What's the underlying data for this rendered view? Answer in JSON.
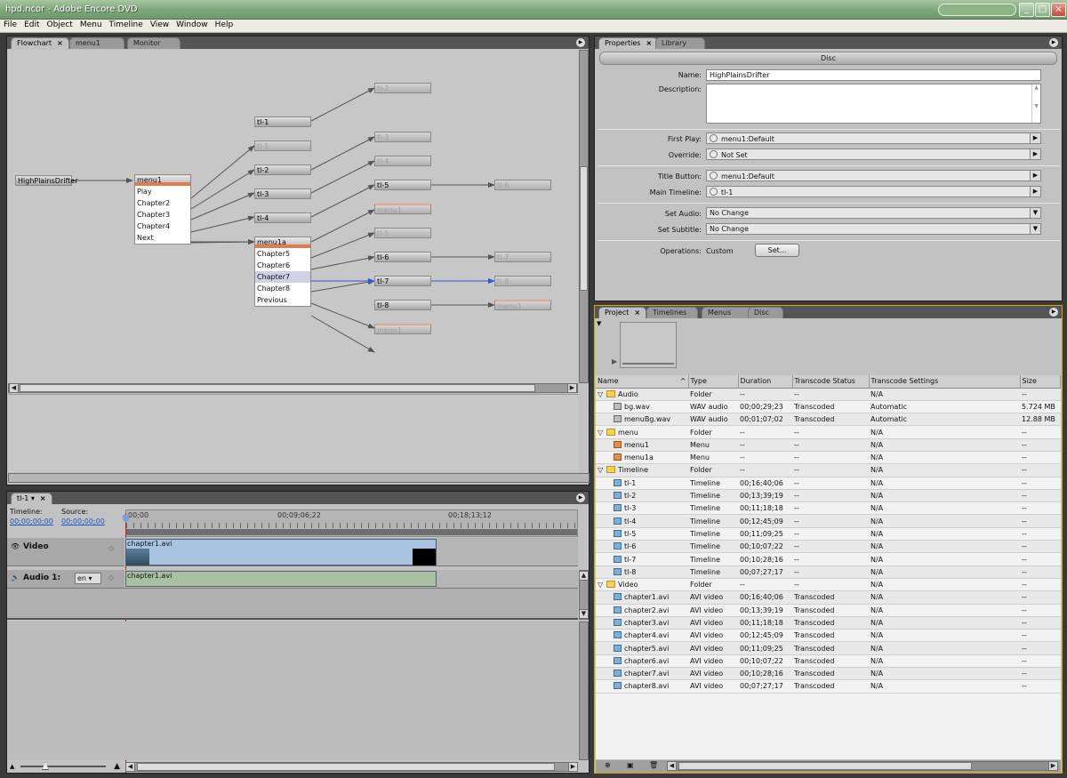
{
  "window": {
    "title": "hpd.ncor - Adobe Encore DVD"
  },
  "menubar": [
    "File",
    "Edit",
    "Object",
    "Menu",
    "Timeline",
    "View",
    "Window",
    "Help"
  ],
  "flowchart_panel": {
    "tabs": [
      "Flowchart",
      "menu1",
      "Monitor"
    ],
    "source_node": "HighPlainsDrifter",
    "menu1": {
      "title": "menu1",
      "items": [
        "Play",
        "Chapter2",
        "Chapter3",
        "Chapter4",
        "Next"
      ]
    },
    "menu1a": {
      "title": "menu1a",
      "items": [
        "Chapter5",
        "Chapter6",
        "Chapter7",
        "Chapter8",
        "Previous"
      ],
      "selected": "Chapter7"
    },
    "col2_nodes": [
      "tl-1",
      "tl-1",
      "tl-2",
      "tl-3",
      "tl-4"
    ],
    "col3_nodes": [
      "tl-2",
      "tl-3",
      "tl-4",
      "tl-5",
      "menu1",
      "tl-5",
      "tl-6",
      "tl-7",
      "tl-8",
      "menu1"
    ],
    "col4_nodes": [
      "tl-6",
      "tl-7",
      "tl-8",
      "menu1"
    ]
  },
  "timeline_panel": {
    "tab": "tl-1",
    "timeline_label": "Timeline:",
    "timeline_tc": "00;00;00;00",
    "source_label": "Source:",
    "source_tc": "00;00;00;00",
    "ruler": [
      "00;00",
      "00;09;06;22",
      "00;18;13;12"
    ],
    "video_track": "Video",
    "video_clip": "chapter1.avi",
    "audio_track": "Audio 1:",
    "audio_lang": "en",
    "audio_clip": "chapter1.avi"
  },
  "properties_panel": {
    "tabs": [
      "Properties",
      "Library"
    ],
    "header": "Disc",
    "name_label": "Name:",
    "name_value": "HighPlainsDrifter",
    "desc_label": "Description:",
    "first_play_label": "First Play:",
    "first_play_value": "menu1:Default",
    "override_label": "Override:",
    "override_value": "Not Set",
    "title_button_label": "Title Button:",
    "title_button_value": "menu1:Default",
    "main_timeline_label": "Main Timeline:",
    "main_timeline_value": "tl-1",
    "set_audio_label": "Set Audio:",
    "set_audio_value": "No Change",
    "set_subtitle_label": "Set Subtitle:",
    "set_subtitle_value": "No Change",
    "operations_label": "Operations:",
    "operations_value": "Custom",
    "set_button": "Set..."
  },
  "project_panel": {
    "tabs": [
      "Project",
      "Timelines",
      "Menus",
      "Disc"
    ],
    "columns": [
      "Name",
      "Type",
      "Duration",
      "Transcode Status",
      "Transcode Settings",
      "Size"
    ],
    "rows": [
      {
        "name": "Audio",
        "type": "Folder",
        "duration": "--",
        "status": "--",
        "settings": "N/A",
        "size": "--",
        "kind": "folder",
        "indent": 0
      },
      {
        "name": "bg.wav",
        "type": "WAV audio",
        "duration": "00;00;29;23",
        "status": "Transcoded",
        "settings": "Automatic",
        "size": "5.724 MB",
        "kind": "audio",
        "indent": 1
      },
      {
        "name": "menuBg.wav",
        "type": "WAV audio",
        "duration": "00;01;07;02",
        "status": "Transcoded",
        "settings": "Automatic",
        "size": "12.88 MB",
        "kind": "audio",
        "indent": 1
      },
      {
        "name": "menu",
        "type": "Folder",
        "duration": "--",
        "status": "--",
        "settings": "N/A",
        "size": "--",
        "kind": "folder",
        "indent": 0
      },
      {
        "name": "menu1",
        "type": "Menu",
        "duration": "--",
        "status": "--",
        "settings": "N/A",
        "size": "--",
        "kind": "menu",
        "indent": 1
      },
      {
        "name": "menu1a",
        "type": "Menu",
        "duration": "--",
        "status": "--",
        "settings": "N/A",
        "size": "--",
        "kind": "menu",
        "indent": 1
      },
      {
        "name": "Timeline",
        "type": "Folder",
        "duration": "--",
        "status": "--",
        "settings": "N/A",
        "size": "--",
        "kind": "folder",
        "indent": 0
      },
      {
        "name": "tl-1",
        "type": "Timeline",
        "duration": "00;16;40;06",
        "status": "--",
        "settings": "N/A",
        "size": "--",
        "kind": "timeline",
        "indent": 1
      },
      {
        "name": "tl-2",
        "type": "Timeline",
        "duration": "00;13;39;19",
        "status": "--",
        "settings": "N/A",
        "size": "--",
        "kind": "timeline",
        "indent": 1
      },
      {
        "name": "tl-3",
        "type": "Timeline",
        "duration": "00;11;18;18",
        "status": "--",
        "settings": "N/A",
        "size": "--",
        "kind": "timeline",
        "indent": 1
      },
      {
        "name": "tl-4",
        "type": "Timeline",
        "duration": "00;12;45;09",
        "status": "--",
        "settings": "N/A",
        "size": "--",
        "kind": "timeline",
        "indent": 1
      },
      {
        "name": "tl-5",
        "type": "Timeline",
        "duration": "00;11;09;25",
        "status": "--",
        "settings": "N/A",
        "size": "--",
        "kind": "timeline",
        "indent": 1
      },
      {
        "name": "tl-6",
        "type": "Timeline",
        "duration": "00;10;07;22",
        "status": "--",
        "settings": "N/A",
        "size": "--",
        "kind": "timeline",
        "indent": 1
      },
      {
        "name": "tl-7",
        "type": "Timeline",
        "duration": "00;10;28;16",
        "status": "--",
        "settings": "N/A",
        "size": "--",
        "kind": "timeline",
        "indent": 1
      },
      {
        "name": "tl-8",
        "type": "Timeline",
        "duration": "00;07;27;17",
        "status": "--",
        "settings": "N/A",
        "size": "--",
        "kind": "timeline",
        "indent": 1
      },
      {
        "name": "Video",
        "type": "Folder",
        "duration": "--",
        "status": "--",
        "settings": "N/A",
        "size": "--",
        "kind": "folder",
        "indent": 0
      },
      {
        "name": "chapter1.avi",
        "type": "AVI video",
        "duration": "00;16;40;06",
        "status": "Transcoded",
        "settings": "N/A",
        "size": "--",
        "kind": "video",
        "indent": 1
      },
      {
        "name": "chapter2.avi",
        "type": "AVI video",
        "duration": "00;13;39;19",
        "status": "Transcoded",
        "settings": "N/A",
        "size": "--",
        "kind": "video",
        "indent": 1
      },
      {
        "name": "chapter3.avi",
        "type": "AVI video",
        "duration": "00;11;18;18",
        "status": "Transcoded",
        "settings": "N/A",
        "size": "--",
        "kind": "video",
        "indent": 1
      },
      {
        "name": "chapter4.avi",
        "type": "AVI video",
        "duration": "00;12;45;09",
        "status": "Transcoded",
        "settings": "N/A",
        "size": "--",
        "kind": "video",
        "indent": 1
      },
      {
        "name": "chapter5.avi",
        "type": "AVI video",
        "duration": "00;11;09;25",
        "status": "Transcoded",
        "settings": "N/A",
        "size": "--",
        "kind": "video",
        "indent": 1
      },
      {
        "name": "chapter6.avi",
        "type": "AVI video",
        "duration": "00;10;07;22",
        "status": "Transcoded",
        "settings": "N/A",
        "size": "--",
        "kind": "video",
        "indent": 1
      },
      {
        "name": "chapter7.avi",
        "type": "AVI video",
        "duration": "00;10;28;16",
        "status": "Transcoded",
        "settings": "N/A",
        "size": "--",
        "kind": "video",
        "indent": 1
      },
      {
        "name": "chapter8.avi",
        "type": "AVI video",
        "duration": "00;07;27;17",
        "status": "Transcoded",
        "settings": "N/A",
        "size": "--",
        "kind": "video",
        "indent": 1
      }
    ]
  },
  "colors": {
    "accent": "#e07c50",
    "selected_link": "#2d5bd6",
    "timecode": "#1a56c8",
    "playhead": "#d02020",
    "project_border": "#e0a000"
  }
}
